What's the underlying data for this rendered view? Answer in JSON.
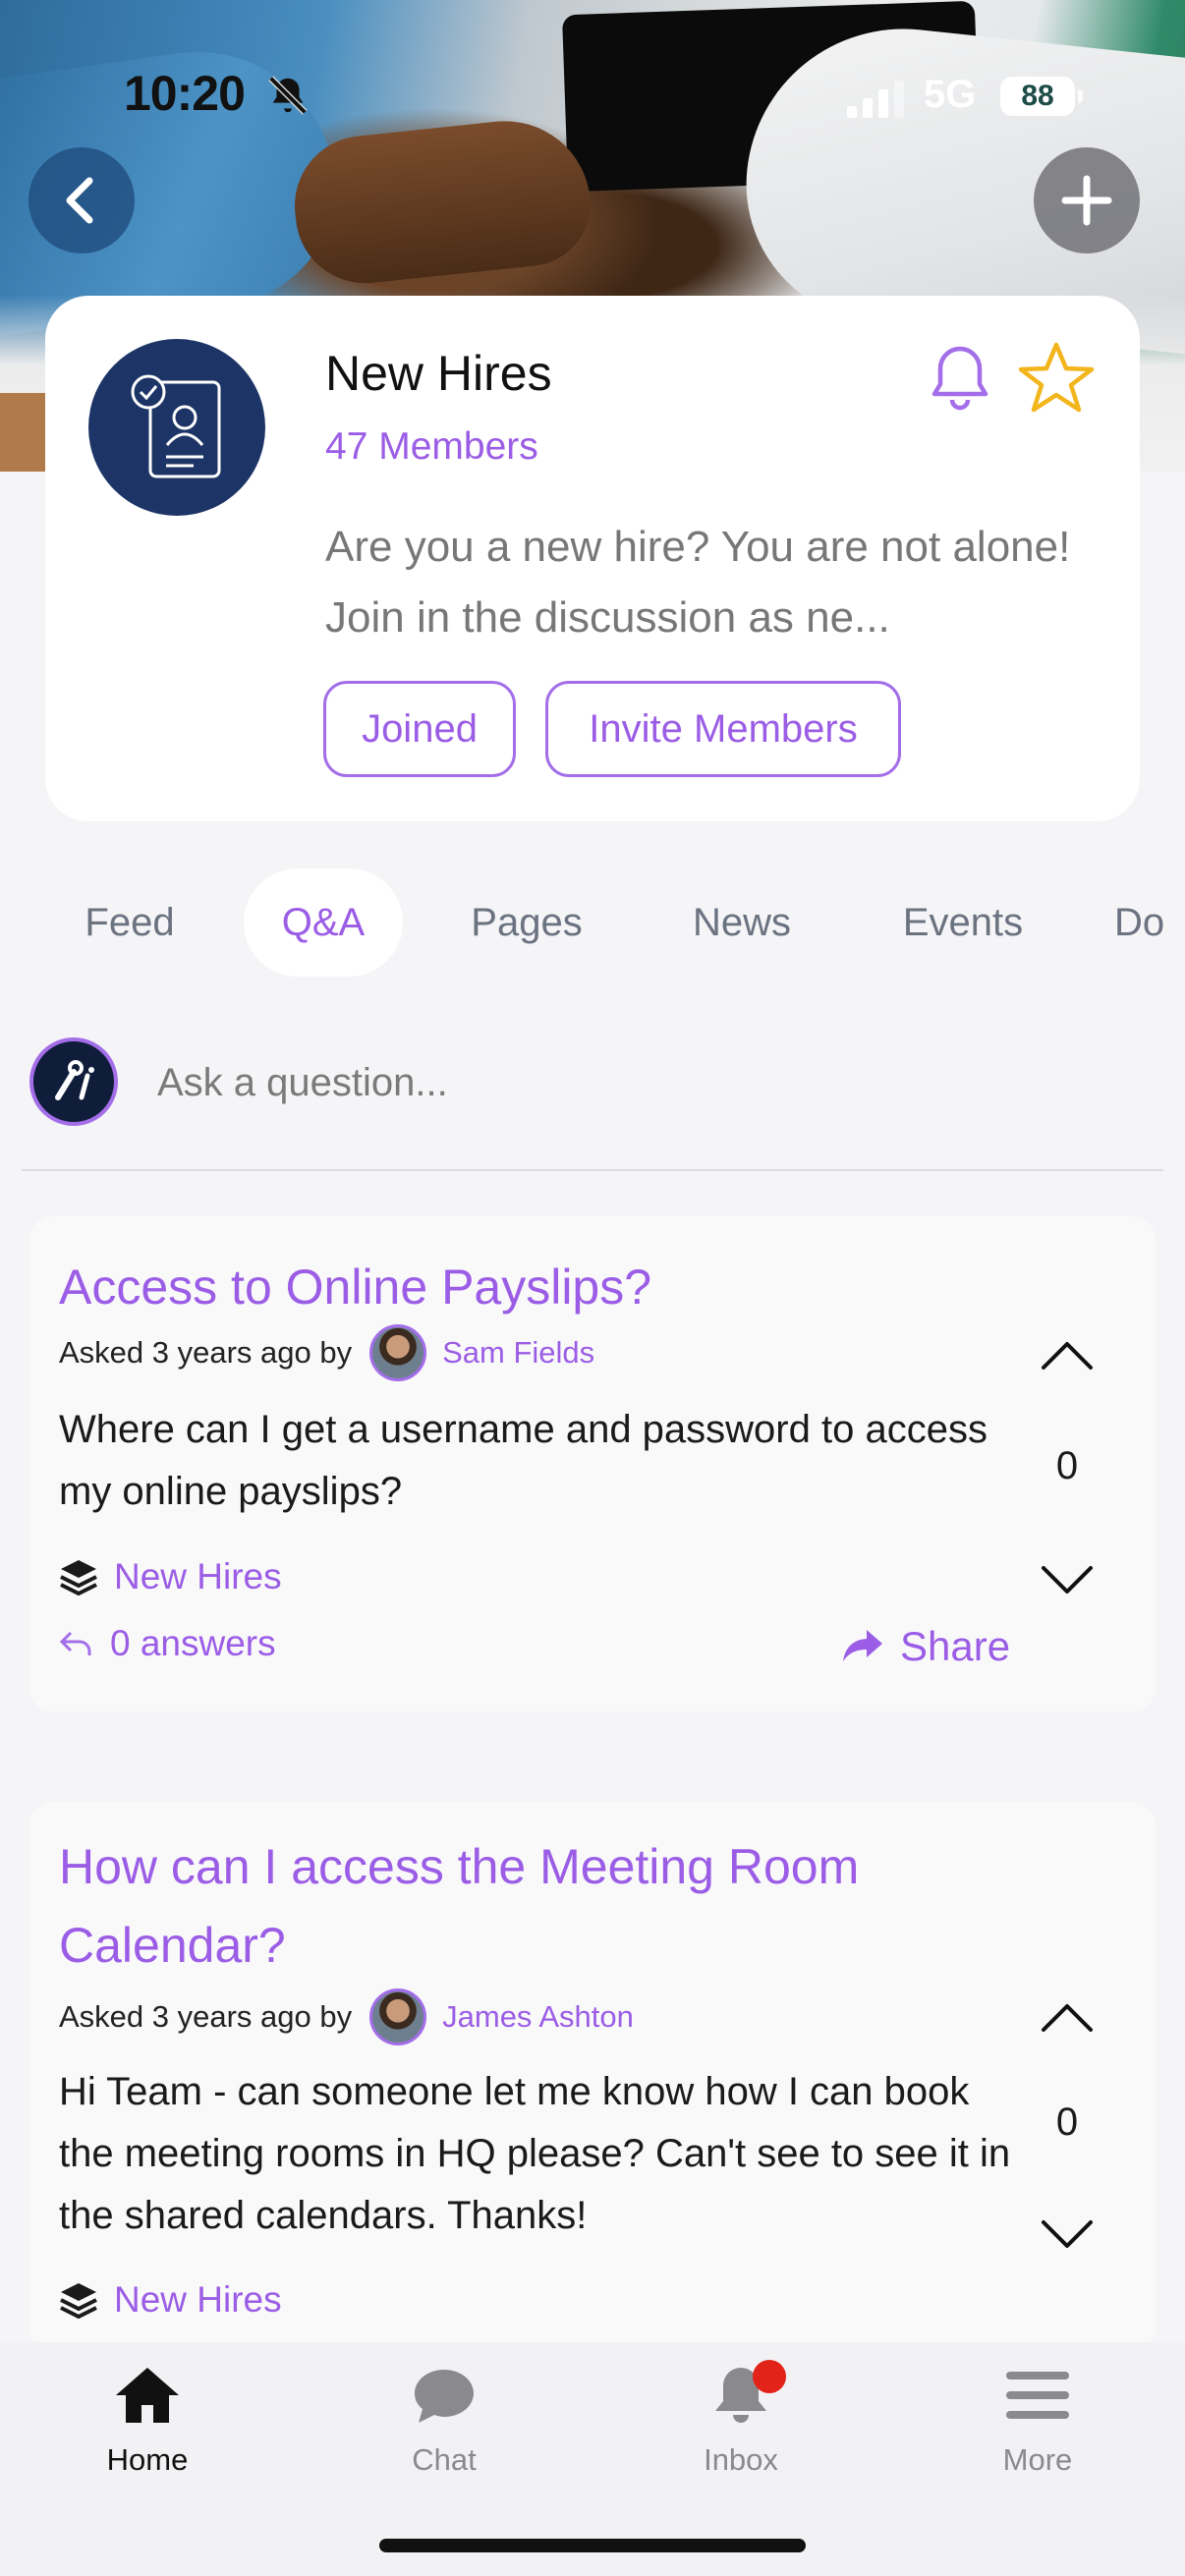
{
  "status_bar": {
    "time": "10:20",
    "network": "5G",
    "battery": "88"
  },
  "group": {
    "title": "New Hires",
    "members": "47 Members",
    "description": "Are you a new hire? You are not alone! Join in the discussion as ne...",
    "joined_label": "Joined",
    "invite_label": "Invite Members"
  },
  "tabs": [
    "Feed",
    "Q&A",
    "Pages",
    "News",
    "Events",
    "Do"
  ],
  "active_tab": "Q&A",
  "ask": {
    "placeholder": "Ask a question..."
  },
  "questions": [
    {
      "title": "Access to Online Payslips?",
      "asked": "Asked 3 years ago by",
      "author": "Sam Fields",
      "body": "Where can I get a username and password to access my online payslips?",
      "votes": "0",
      "tag": "New Hires",
      "answers": "0 answers",
      "share": "Share"
    },
    {
      "title": "How can I access the Meeting Room Calendar?",
      "asked": "Asked 3 years ago by",
      "author": "James Ashton",
      "body": "Hi Team - can someone let me know how I can book the meeting rooms in HQ please? Can't see to see it in the shared calendars. Thanks!",
      "votes": "0",
      "tag": "New Hires"
    }
  ],
  "bottom_nav": {
    "home": "Home",
    "chat": "Chat",
    "inbox": "Inbox",
    "more": "More"
  },
  "colors": {
    "accent": "#9b5de5",
    "star": "#f2b51c",
    "group_avatar_bg": "#1d3566",
    "notification": "#e2231a"
  }
}
